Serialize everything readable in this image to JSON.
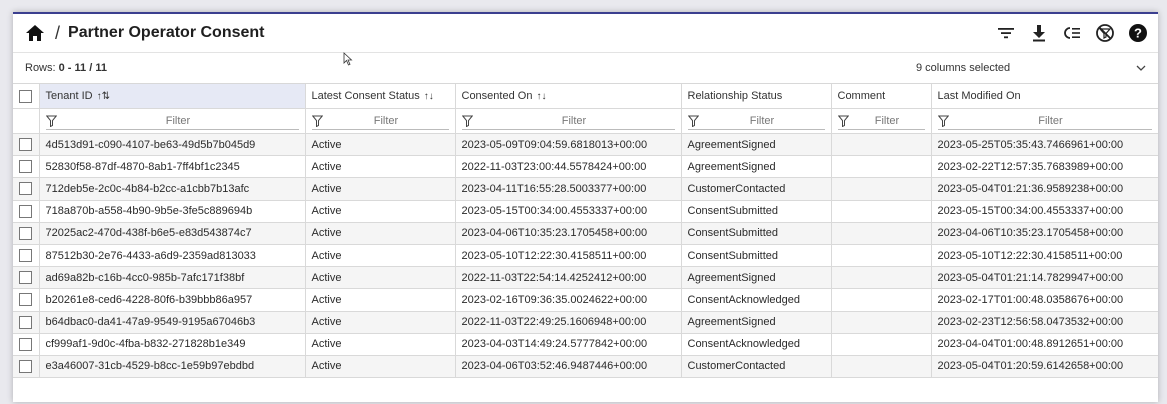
{
  "header": {
    "separator": "/",
    "title": "Partner Operator Consent",
    "icons": [
      "home-icon",
      "filter-icon",
      "download-icon",
      "column-chooser-icon",
      "clear-filter-icon",
      "help-icon"
    ]
  },
  "subbar": {
    "rows_label": "Rows:",
    "rows_value": "0 - 11 / 11",
    "columns_selected": "9 columns selected"
  },
  "columns": [
    {
      "label": "Tenant ID",
      "sort": "↑⇅"
    },
    {
      "label": "Latest Consent Status",
      "sort": "↑↓"
    },
    {
      "label": "Consented On",
      "sort": "↑↓"
    },
    {
      "label": "Relationship Status",
      "sort": ""
    },
    {
      "label": "Comment",
      "sort": ""
    },
    {
      "label": "Last Modified On",
      "sort": ""
    }
  ],
  "filter_placeholder": "Filter",
  "rows": [
    [
      "4d513d91-c090-4107-be63-49d5b7b045d9",
      "Active",
      "2023-05-09T09:04:59.6818013+00:00",
      "AgreementSigned",
      "",
      "2023-05-25T05:35:43.7466961+00:00"
    ],
    [
      "52830f58-87df-4870-8ab1-7ff4bf1c2345",
      "Active",
      "2022-11-03T23:00:44.5578424+00:00",
      "AgreementSigned",
      "",
      "2023-02-22T12:57:35.7683989+00:00"
    ],
    [
      "712deb5e-2c0c-4b84-b2cc-a1cbb7b13afc",
      "Active",
      "2023-04-11T16:55:28.5003377+00:00",
      "CustomerContacted",
      "",
      "2023-05-04T01:21:36.9589238+00:00"
    ],
    [
      "718a870b-a558-4b90-9b5e-3fe5c889694b",
      "Active",
      "2023-05-15T00:34:00.4553337+00:00",
      "ConsentSubmitted",
      "",
      "2023-05-15T00:34:00.4553337+00:00"
    ],
    [
      "72025ac2-470d-438f-b6e5-e83d543874c7",
      "Active",
      "2023-04-06T10:35:23.1705458+00:00",
      "ConsentSubmitted",
      "",
      "2023-04-06T10:35:23.1705458+00:00"
    ],
    [
      "87512b30-2e76-4433-a6d9-2359ad813033",
      "Active",
      "2023-05-10T12:22:30.4158511+00:00",
      "ConsentSubmitted",
      "",
      "2023-05-10T12:22:30.4158511+00:00"
    ],
    [
      "ad69a82b-c16b-4cc0-985b-7afc171f38bf",
      "Active",
      "2022-11-03T22:54:14.4252412+00:00",
      "AgreementSigned",
      "",
      "2023-05-04T01:21:14.7829947+00:00"
    ],
    [
      "b20261e8-ced6-4228-80f6-b39bbb86a957",
      "Active",
      "2023-02-16T09:36:35.0024622+00:00",
      "ConsentAcknowledged",
      "",
      "2023-02-17T01:00:48.0358676+00:00"
    ],
    [
      "b64dbac0-da41-47a9-9549-9195a67046b3",
      "Active",
      "2022-11-03T22:49:25.1606948+00:00",
      "AgreementSigned",
      "",
      "2023-02-23T12:56:58.0473532+00:00"
    ],
    [
      "cf999af1-9d0c-4fba-b832-271828b1e349",
      "Active",
      "2023-04-03T14:49:24.5777842+00:00",
      "ConsentAcknowledged",
      "",
      "2023-04-04T01:00:48.8912651+00:00"
    ],
    [
      "e3a46007-31cb-4529-b8cc-1e59b97ebdbd",
      "Active",
      "2023-04-06T03:52:46.9487446+00:00",
      "CustomerContacted",
      "",
      "2023-05-04T01:20:59.6142658+00:00"
    ]
  ]
}
